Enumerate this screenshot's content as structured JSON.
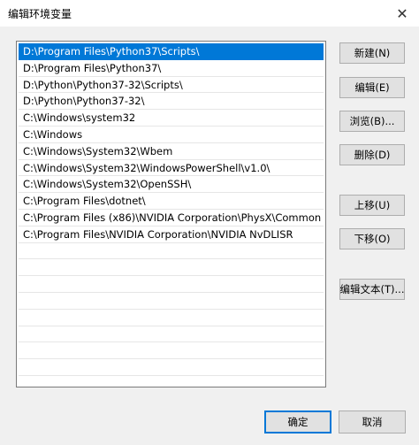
{
  "window": {
    "title": "编辑环境变量",
    "close_label": "✕"
  },
  "list": {
    "items": [
      "D:\\Program Files\\Python37\\Scripts\\",
      "D:\\Program Files\\Python37\\",
      "D:\\Python\\Python37-32\\Scripts\\",
      "D:\\Python\\Python37-32\\",
      "C:\\Windows\\system32",
      "C:\\Windows",
      "C:\\Windows\\System32\\Wbem",
      "C:\\Windows\\System32\\WindowsPowerShell\\v1.0\\",
      "C:\\Windows\\System32\\OpenSSH\\",
      "C:\\Program Files\\dotnet\\",
      "C:\\Program Files (x86)\\NVIDIA Corporation\\PhysX\\Common",
      "C:\\Program Files\\NVIDIA Corporation\\NVIDIA NvDLISR"
    ],
    "selected_index": 0
  },
  "buttons": {
    "new": "新建(N)",
    "edit": "编辑(E)",
    "browse": "浏览(B)...",
    "delete": "删除(D)",
    "move_up": "上移(U)",
    "move_down": "下移(O)",
    "edit_text": "编辑文本(T)...",
    "ok": "确定",
    "cancel": "取消"
  },
  "colors": {
    "selection": "#0078d7"
  }
}
